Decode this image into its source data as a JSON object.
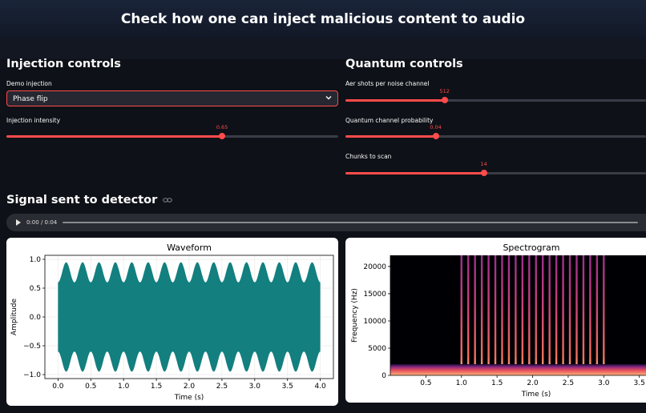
{
  "header": {
    "title": "Check how one can inject malicious content to audio"
  },
  "injection": {
    "title": "Injection controls",
    "demo_label": "Demo injection",
    "demo_value": "Phase flip",
    "intensity_label": "Injection intensity",
    "intensity_value": "0.65",
    "intensity_fraction": 0.65
  },
  "quantum": {
    "title": "Quantum controls",
    "shots_label": "Aer shots per noise channel",
    "shots_value": "512",
    "shots_fraction": 0.33,
    "prob_label": "Quantum channel probability",
    "prob_value": "0.04",
    "prob_fraction": 0.3,
    "chunks_label": "Chunks to scan",
    "chunks_value": "14",
    "chunks_fraction": 0.46
  },
  "signal": {
    "title": "Signal sent to detector",
    "link_icon": "link-icon",
    "audio_time": "0:00 / 0:04"
  },
  "chart_data": [
    {
      "type": "area",
      "title": "Waveform",
      "xlabel": "Time (s)",
      "ylabel": "Amplitude",
      "xlim": [
        -0.2,
        4.2
      ],
      "ylim": [
        -1.07,
        1.07
      ],
      "xticks": [
        "0.0",
        "0.5",
        "1.0",
        "1.5",
        "2.0",
        "2.5",
        "3.0",
        "3.5",
        "4.0"
      ],
      "yticks": [
        "1.0",
        "0.5",
        "0.0",
        "−0.5",
        "−1.0"
      ],
      "envelope": {
        "x_start": 0.0,
        "x_end": 4.0,
        "cycles": 16,
        "max": 0.95,
        "min": 0.6
      },
      "grid": true,
      "color": "#137f7f"
    },
    {
      "type": "heatmap",
      "title": "Spectrogram",
      "xlabel": "Time (s)",
      "ylabel": "Frequency (Hz)",
      "xlim": [
        0,
        3.65
      ],
      "ylim": [
        0,
        22050
      ],
      "xticks": [
        "0.5",
        "1.0",
        "1.5",
        "2.0",
        "2.5",
        "3.0",
        "3.5"
      ],
      "yticks": [
        "20000",
        "15000",
        "10000",
        "5000",
        "0"
      ],
      "burst_lines_start": 1.0,
      "burst_lines_end": 3.0,
      "burst_lines_count": 22,
      "colormap": "magma"
    }
  ]
}
